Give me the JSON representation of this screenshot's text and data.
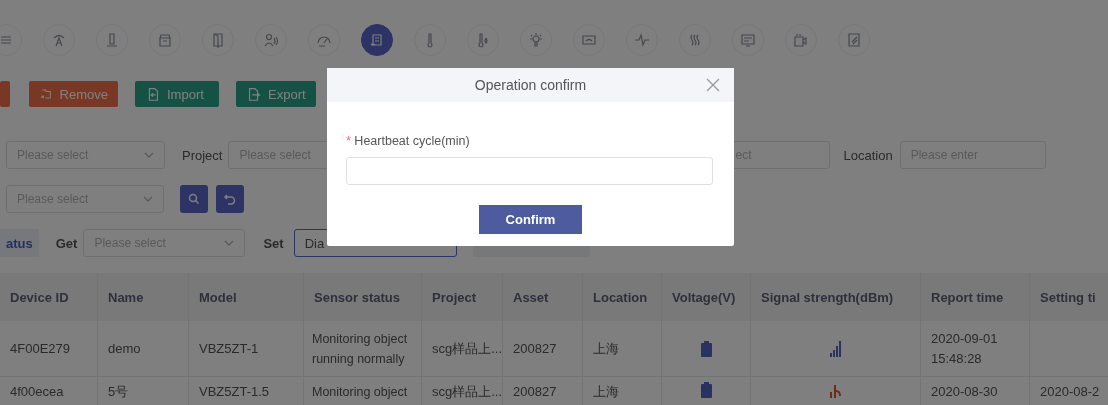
{
  "toolbar_icons": [
    {
      "kind": "waves",
      "selected": false
    },
    {
      "kind": "antenna",
      "selected": false
    },
    {
      "kind": "pillar",
      "selected": false
    },
    {
      "kind": "box",
      "selected": false
    },
    {
      "kind": "door",
      "selected": false
    },
    {
      "kind": "person-sound",
      "selected": false
    },
    {
      "kind": "gauge",
      "selected": false
    },
    {
      "kind": "device",
      "selected": true
    },
    {
      "kind": "thermometer",
      "selected": false
    },
    {
      "kind": "thermo-drop",
      "selected": false
    },
    {
      "kind": "bulb",
      "selected": false
    },
    {
      "kind": "meter",
      "selected": false
    },
    {
      "kind": "pulse",
      "selected": false
    },
    {
      "kind": "heat",
      "selected": false
    },
    {
      "kind": "display",
      "selected": false
    },
    {
      "kind": "camera-speaker",
      "selected": false
    },
    {
      "kind": "panel",
      "selected": false
    }
  ],
  "actions": [
    {
      "kind": "cut"
    },
    {
      "kind": "remove",
      "label": "Remove"
    },
    {
      "kind": "import",
      "label": "Import"
    },
    {
      "kind": "export",
      "label": "Export"
    }
  ],
  "filters": {
    "row_1": {
      "select_1": "Please select",
      "project_label": "Project",
      "project_select": "Please select",
      "select_3": "ect",
      "location_label": "Location",
      "location_input": "Please enter"
    },
    "row_2": {
      "select": "Please select"
    },
    "row_3": {
      "tab": "atus",
      "get_label": "Get",
      "get_select": "Please select",
      "set_label": "Set",
      "set_select": "Dia"
    }
  },
  "table": {
    "columns": [
      "Device ID",
      "Name",
      "Model",
      "Sensor status",
      "Project",
      "Asset",
      "Location",
      "Voltage(V)",
      "Signal strength(dBm)",
      "Report time",
      "Setting ti"
    ],
    "rows": [
      {
        "device_id": "4F00E279",
        "name": "demo",
        "model": "VBZ5ZT-1",
        "status": "Monitoring object running normally",
        "project": "scg样品上...",
        "asset": "200827",
        "location": "上海",
        "weak_signal": false,
        "report_time": "2020-09-01 15:48:28"
      },
      {
        "device_id": "4f00ecea",
        "name": "5号",
        "model": "VBZ5ZT-1.5",
        "status": "Monitoring object",
        "project": "scg样品上...",
        "asset": "200827",
        "location": "上海",
        "weak_signal": true,
        "report_time": "2020-08-30",
        "setting_time": "2020-08-2"
      }
    ]
  },
  "dialog": {
    "title": "Operation confirm",
    "field_label": "Heartbeat cycle(min)",
    "required_mark": "*",
    "confirm": "Confirm"
  }
}
